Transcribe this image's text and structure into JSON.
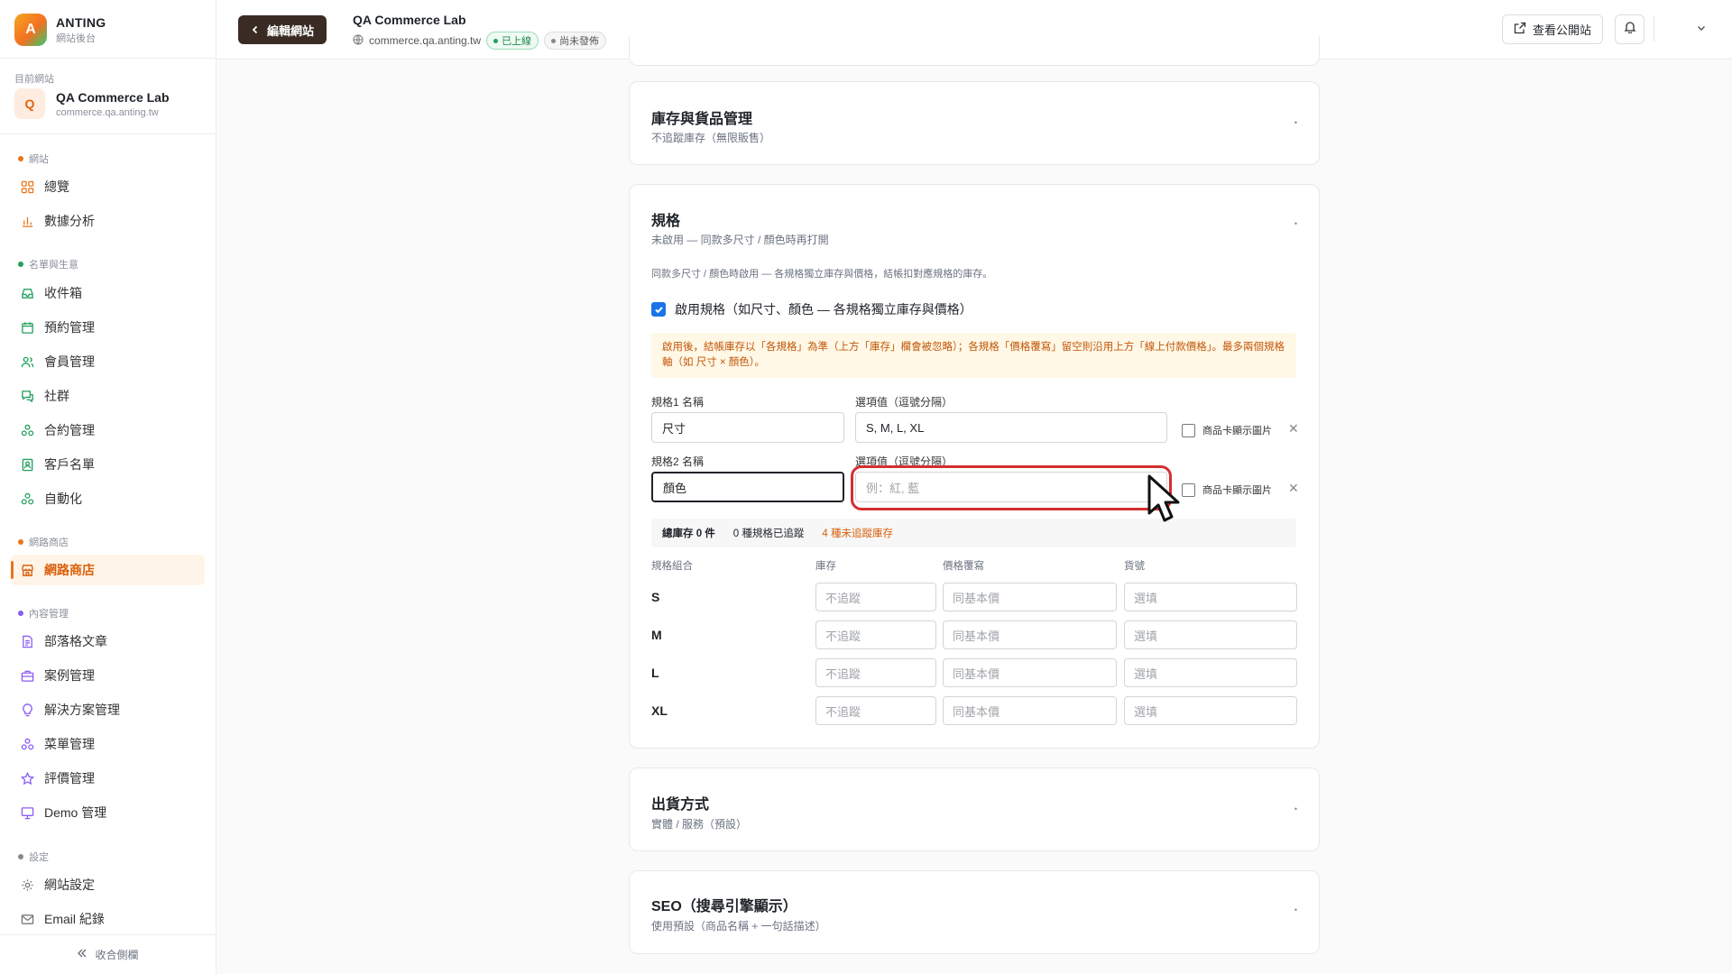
{
  "brand": {
    "logo_letter": "A",
    "name": "ANTING",
    "sub": "網站後台"
  },
  "site": {
    "section_label": "目前網站",
    "avatar_letter": "Q",
    "name": "QA Commerce Lab",
    "domain": "commerce.qa.anting.tw"
  },
  "nav": {
    "groups": [
      {
        "label": "網站",
        "color": "#e8761e"
      },
      {
        "label": "名單與生意",
        "color": "#22a05b"
      },
      {
        "label": "網路商店",
        "color": "#e8761e"
      },
      {
        "label": "內容管理",
        "color": "#8b5cf6"
      },
      {
        "label": "設定",
        "color": "#888888"
      }
    ],
    "items": [
      {
        "label": "總覽",
        "icon": "grid-icon"
      },
      {
        "label": "數據分析",
        "icon": "bar-chart-icon"
      },
      {
        "label": "收件箱",
        "icon": "inbox-icon"
      },
      {
        "label": "預約管理",
        "icon": "calendar-icon"
      },
      {
        "label": "會員管理",
        "icon": "users-icon"
      },
      {
        "label": "社群",
        "icon": "chat-icon"
      },
      {
        "label": "合約管理",
        "icon": "cluster-icon"
      },
      {
        "label": "客戶名單",
        "icon": "contact-icon"
      },
      {
        "label": "自動化",
        "icon": "cluster-icon"
      },
      {
        "label": "網路商店",
        "icon": "store-icon"
      },
      {
        "label": "部落格文章",
        "icon": "document-icon"
      },
      {
        "label": "案例管理",
        "icon": "briefcase-icon"
      },
      {
        "label": "解決方案管理",
        "icon": "lightbulb-icon"
      },
      {
        "label": "菜單管理",
        "icon": "cluster-icon"
      },
      {
        "label": "評價管理",
        "icon": "star-icon"
      },
      {
        "label": "Demo 管理",
        "icon": "monitor-icon"
      },
      {
        "label": "網站設定",
        "icon": "gear-icon"
      },
      {
        "label": "Email 紀錄",
        "icon": "mail-icon"
      }
    ],
    "collapse_label": "收合側欄"
  },
  "topbar": {
    "back_label": "編輯網站",
    "title": "QA Commerce Lab",
    "domain": "commerce.qa.anting.tw",
    "badge_live": "已上線",
    "badge_draft": "尚未發佈",
    "view_label": "查看公開站"
  },
  "cards": {
    "inventory": {
      "title": "庫存與貨品管理",
      "sub": "不追蹤庫存（無限販售）"
    },
    "variants": {
      "title": "規格",
      "sub": "未啟用 — 同款多尺寸 / 顏色時再打開",
      "desc": "同款多尺寸 / 顏色時啟用 — 各規格獨立庫存與價格，結帳扣對應規格的庫存。",
      "enable_label": "啟用規格（如尺寸、顏色 — 各規格獨立庫存與價格）",
      "notice": "啟用後，結帳庫存以「各規格」為準（上方「庫存」欄會被忽略）；各規格「價格覆寫」留空則沿用上方「線上付款價格」。最多兩個規格軸（如 尺寸 × 顏色）。",
      "axis1_label": "規格1 名稱",
      "axis1_value": "尺寸",
      "options_label": "選項值（逗號分隔）",
      "axis1_options": "S, M, L, XL",
      "show_image_label": "商品卡顯示圖片",
      "axis2_label": "規格2 名稱",
      "axis2_value": "顏色",
      "axis2_placeholder": "例：紅, 藍",
      "summary_total": "總庫存 0 件",
      "summary_tracked": "0 種規格已追蹤",
      "summary_untracked": "4 種未追蹤庫存",
      "columns": [
        "規格組合",
        "庫存",
        "價格覆寫",
        "貨號"
      ],
      "stock_placeholder": "不追蹤",
      "price_placeholder": "同基本價",
      "sku_placeholder": "選填",
      "rows": [
        "S",
        "M",
        "L",
        "XL"
      ]
    },
    "shipping": {
      "title": "出貨方式",
      "sub": "實體 / 服務（預設）"
    },
    "seo": {
      "title": "SEO（搜尋引擎顯示）",
      "sub": "使用預設（商品名稱 + 一句話描述）"
    }
  },
  "colors": {
    "accent": "#e8761e",
    "primary_dark": "#3a2c25",
    "checkbox": "#1a73e8",
    "highlight": "#d32f2f"
  }
}
